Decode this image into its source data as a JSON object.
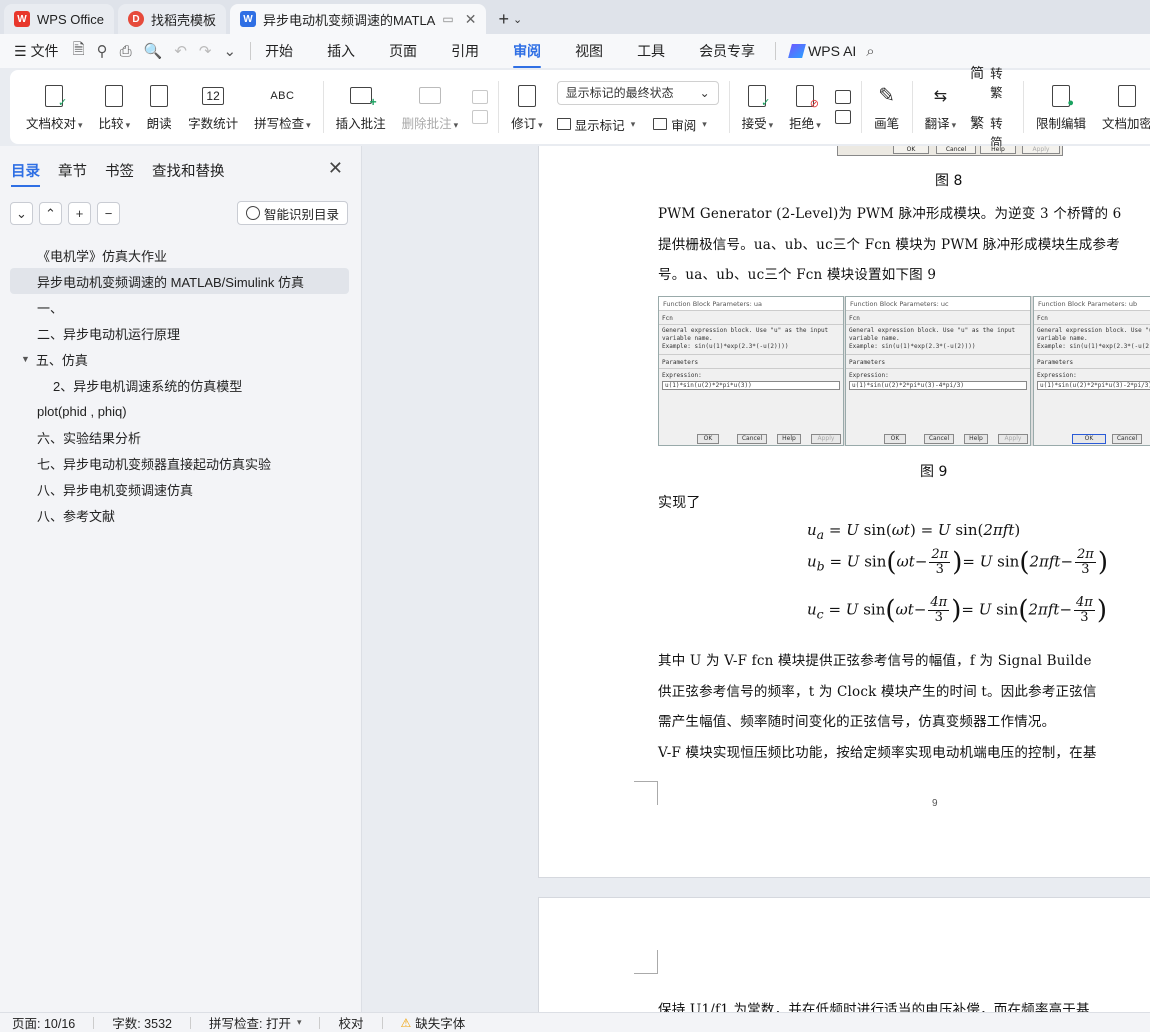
{
  "tabs": [
    {
      "label": "WPS Office",
      "icon": "wps-logo-icon"
    },
    {
      "label": "找稻壳模板",
      "icon": "docer-icon"
    },
    {
      "label": "异步电动机变频调速的MATLA",
      "icon": "writer-doc-icon",
      "active": true
    }
  ],
  "menubar": {
    "file": "文件",
    "items": [
      "开始",
      "插入",
      "页面",
      "引用",
      "审阅",
      "视图",
      "工具",
      "会员专享"
    ],
    "active": "审阅",
    "wps_ai": "WPS AI"
  },
  "ribbon": {
    "doc_check": "文档校对",
    "compare": "比较",
    "read_aloud": "朗读",
    "word_count": "字数统计",
    "word_count_icon_text": "12",
    "spell_check": "拼写检查",
    "abc": "ABC",
    "insert_comment": "插入批注",
    "delete_comment": "删除批注",
    "revise": "修订",
    "markup_state": "显示标记的最终状态",
    "show_markup": "显示标记",
    "review": "审阅",
    "accept": "接受",
    "reject": "拒绝",
    "pen": "画笔",
    "translate": "翻译",
    "to_traditional": "转繁",
    "to_simplified": "转简",
    "trad_glyph": "简",
    "simp_glyph": "繁",
    "restrict_edit": "限制编辑",
    "doc_encrypt": "文档加密"
  },
  "sidebar": {
    "tabs": [
      "目录",
      "章节",
      "书签",
      "查找和替换"
    ],
    "active_tab": "目录",
    "smart_button": "智能识别目录",
    "toc": [
      {
        "label": "《电机学》仿真大作业",
        "level": 1
      },
      {
        "label": "异步电动机变频调速的 MATLAB/Simulink 仿真",
        "level": 1,
        "active": true
      },
      {
        "label": "一、",
        "level": 1
      },
      {
        "label": "二、异步电动机运行原理",
        "level": 1
      },
      {
        "label": "五、仿真",
        "level": 1,
        "expanded": true
      },
      {
        "label": "2、异步电机调速系统的仿真模型",
        "level": 2
      },
      {
        "label": "plot(phid , phiq)",
        "level": 1
      },
      {
        "label": "六、实验结果分析",
        "level": 1
      },
      {
        "label": "七、异步电动机变频器直接起动仿真实验",
        "level": 1
      },
      {
        "label": "八、异步电机变频调速仿真",
        "level": 1
      },
      {
        "label": "八、参考文献",
        "level": 1
      }
    ]
  },
  "document": {
    "fig8_caption": "图 8",
    "fig8_buttons": [
      "OK",
      "Cancel",
      "Help",
      "Apply"
    ],
    "para1": [
      "PWM Generator (2-Level)为 PWM 脉冲形成模块。为逆变 3 个桥臂的 6",
      "提供栅极信号。ua、ub、uc三个 Fcn 模块为 PWM 脉冲形成模块生成参考",
      "号。ua、ub、uc三个 Fcn 模块设置如下图 9"
    ],
    "dialogs": [
      {
        "title": "Function Block Parameters: ua",
        "expr": "u(1)*sin(u(2)*2*pi*u(3))"
      },
      {
        "title": "Function Block Parameters: uc",
        "expr": "u(1)*sin(u(2)*2*pi*u(3)-4*pi/3)"
      },
      {
        "title": "Function Block Parameters: ub",
        "expr": "u(1)*sin(u(2)*2*pi*u(3)-2*pi/3)"
      }
    ],
    "dialog_lines": {
      "fcn": "Fcn",
      "desc1": "General expression block. Use \"u\" as the input",
      "desc2": "variable name.",
      "example": "Example: sin(u(1)*exp(2.3*(-u(2))))",
      "params": "Parameters",
      "expression": "Expression:",
      "buttons": [
        "OK",
        "Cancel",
        "Help",
        "Apply"
      ]
    },
    "fig9_caption": "图 9",
    "realized": "实现了",
    "para2": [
      "其中 U 为 V-F fcn 模块提供正弦参考信号的幅值，f 为 Signal Builde",
      "供正弦参考信号的频率，t 为 Clock 模块产生的时间 t。因此参考正弦信",
      "需产生幅值、频率随时间变化的正弦信号，仿真变频器工作情况。",
      "V-F 模块实现恒压频比功能，按给定频率实现电动机端电压的控制，在基"
    ],
    "page_number": "9",
    "page2_text": "保持 U1/f1 为常数，并在低频时进行适当的电压补偿，而在频率高于基"
  },
  "statusbar": {
    "page": "页面: 10/16",
    "words": "字数: 3532",
    "spell": "拼写检查: 打开",
    "proof": "校对",
    "missing_font": "缺失字体"
  }
}
